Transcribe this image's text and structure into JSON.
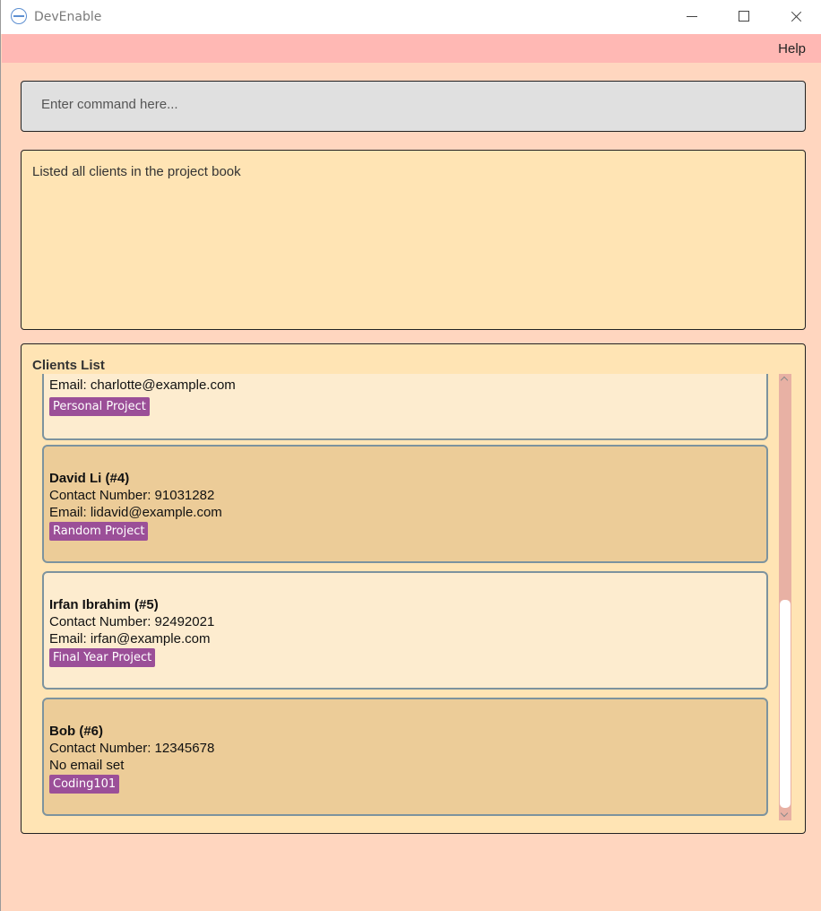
{
  "window": {
    "title": "DevEnable"
  },
  "menu": {
    "help": "Help"
  },
  "command": {
    "placeholder": "Enter command here...",
    "value": ""
  },
  "result": {
    "message": "Listed all clients in the project book"
  },
  "clients_list": {
    "title": "Clients List",
    "partial_card": {
      "email": "Email: charlotte@example.com",
      "tag": "Personal Project"
    },
    "cards": [
      {
        "name": "David Li (#4)",
        "contact": "Contact Number: 91031282",
        "email": "Email: lidavid@example.com",
        "tag": "Random Project"
      },
      {
        "name": "Irfan Ibrahim (#5)",
        "contact": "Contact Number: 92492021",
        "email": "Email: irfan@example.com",
        "tag": "Final Year Project"
      },
      {
        "name": "Bob (#6)",
        "contact": "Contact Number: 12345678",
        "email": "No email set",
        "tag": "Coding101"
      }
    ]
  },
  "colors": {
    "background": "#ffd6bf",
    "menubar": "#ffb8b4",
    "panel": "#ffe4b4",
    "card_light": "#fdeccf",
    "card_dark": "#eccc98",
    "tag": "#9b4f98"
  }
}
